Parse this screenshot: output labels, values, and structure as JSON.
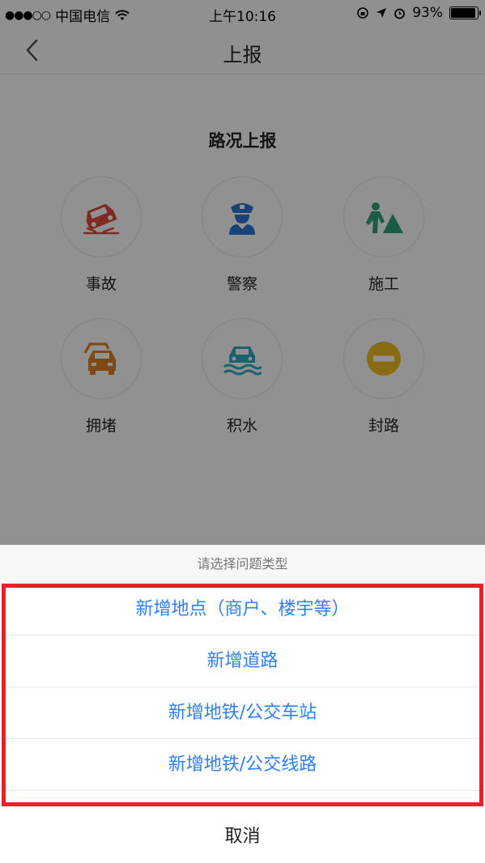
{
  "status_bar": {
    "carrier": "中国电信",
    "time": "上午10:16",
    "battery": "93%"
  },
  "nav": {
    "title": "上报"
  },
  "main": {
    "section_title": "路况上报",
    "items": [
      {
        "label": "事故",
        "icon": "car-crash-icon",
        "color": "#d0483a"
      },
      {
        "label": "警察",
        "icon": "police-icon",
        "color": "#2b6fc9"
      },
      {
        "label": "施工",
        "icon": "construction-icon",
        "color": "#2a9a6e"
      },
      {
        "label": "拥堵",
        "icon": "traffic-jam-icon",
        "color": "#d27a1e"
      },
      {
        "label": "积水",
        "icon": "flooding-icon",
        "color": "#2aa3b8"
      },
      {
        "label": "封路",
        "icon": "road-closed-icon",
        "color": "#e5b21e"
      }
    ]
  },
  "sheet": {
    "header": "请选择问题类型",
    "options": [
      "新增地点（商户、楼宇等）",
      "新增道路",
      "新增地铁/公交车站",
      "新增地铁/公交线路"
    ],
    "cancel": "取消",
    "accent_color": "#2f7ff6",
    "highlight_color": "#e8202a"
  }
}
